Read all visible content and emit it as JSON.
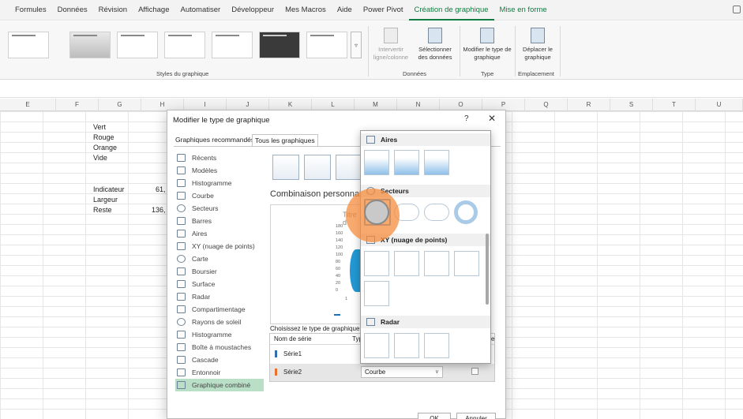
{
  "ribbon_tabs": [
    "Formules",
    "Données",
    "Révision",
    "Affichage",
    "Automatiser",
    "Développeur",
    "Mes Macros",
    "Aide",
    "Power Pivot",
    "Création de graphique",
    "Mise en forme"
  ],
  "ribbon": {
    "styles_group_label": "Styles du graphique",
    "data_group_label": "Données",
    "type_group_label": "Type",
    "location_group_label": "Emplacement",
    "switch_row_col": "Intervertir ligne/colonne",
    "select_data": "Sélectionner des données",
    "change_type": "Modifier le type de graphique",
    "move_chart": "Déplacer le graphique",
    "scroll_glyph": "▿"
  },
  "columns": [
    "E",
    "F",
    "G",
    "H",
    "I",
    "J",
    "K",
    "L",
    "M",
    "N",
    "O",
    "P",
    "Q",
    "R",
    "S",
    "T",
    "U"
  ],
  "cells": {
    "vert": "Vert",
    "rouge": "Rouge",
    "orange": "Orange",
    "vide": "Vide",
    "indicateur": "Indicateur",
    "indicateur_value": "61,",
    "largeur": "Largeur",
    "reste": "Reste",
    "reste_value": "136,"
  },
  "dialog": {
    "title": "Modifier le type de graphique",
    "help": "?",
    "close": "✕",
    "tab_recommended": "Graphiques recommandés",
    "tab_all": "Tous les graphiques",
    "categories": [
      "Récents",
      "Modèles",
      "Histogramme",
      "Courbe",
      "Secteurs",
      "Barres",
      "Aires",
      "XY (nuage de points)",
      "Carte",
      "Boursier",
      "Surface",
      "Radar",
      "Compartimentage",
      "Rayons de soleil",
      "Histogramme",
      "Boîte à moustaches",
      "Cascade",
      "Entonnoir",
      "Graphique combiné"
    ],
    "combo_title": "Combinaison personnali",
    "preview_title": "Titre d",
    "y_ticks": [
      "180",
      "160",
      "140",
      "120",
      "100",
      "80",
      "60",
      "40",
      "20",
      "0"
    ],
    "preview_x": "1",
    "choose_label": "Choisissez le type de graphique e",
    "series_header_name": "Nom de série",
    "series_header_type": "Typ",
    "series_header_axis": "e",
    "series": [
      {
        "name": "Série1",
        "type": "",
        "color": "#2f6fb0"
      },
      {
        "name": "Série2",
        "type": "Courbe",
        "color": "#e8722c"
      }
    ],
    "select_arrow": "∨",
    "ok": "OK",
    "cancel": "Annuler"
  },
  "popup": {
    "sections": [
      "Aires",
      "Secteurs",
      "XY (nuage de points)",
      "Radar"
    ]
  },
  "colors": {
    "accent": "#107c41",
    "selected_category_bg": "#b9dfc7",
    "cursor_highlight": "#f58c3c"
  }
}
